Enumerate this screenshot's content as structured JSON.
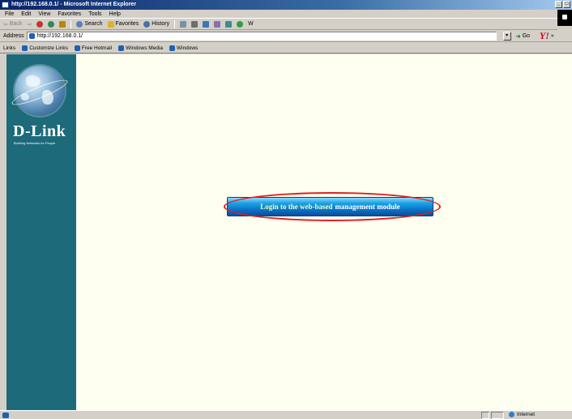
{
  "window": {
    "title": "http://192.168.0.1/ - Microsoft Internet Explorer",
    "min_glyph": "_",
    "max_glyph": "□",
    "close_glyph": "×"
  },
  "menu": [
    "File",
    "Edit",
    "View",
    "Favorites",
    "Tools",
    "Help"
  ],
  "toolbar": {
    "back": "Back",
    "back_arrow": "⇦",
    "forward_arrow": "⇨",
    "search": "Search",
    "favorites": "Favorites",
    "history": "History",
    "extra": "W"
  },
  "address": {
    "label": "Address",
    "url": "http://192.168.0.1/",
    "go_label": "Go",
    "search_brand": "Y!"
  },
  "links": {
    "label": "Links",
    "items": [
      "Customize Links",
      "Free Hotmail",
      "Windows Media",
      "Windows"
    ]
  },
  "sidebar": {
    "brand": "D-Link",
    "tagline": "Building Networks for People"
  },
  "main": {
    "login_part_a": "Login to the web-based",
    "login_part_b": "management module"
  },
  "status": {
    "zone": "Internet"
  },
  "colors": {
    "sidebar": "#1d6a7a",
    "page_bg": "#fffff0",
    "button_blue": "#0a6fc2",
    "highlight": "#e0201f"
  }
}
